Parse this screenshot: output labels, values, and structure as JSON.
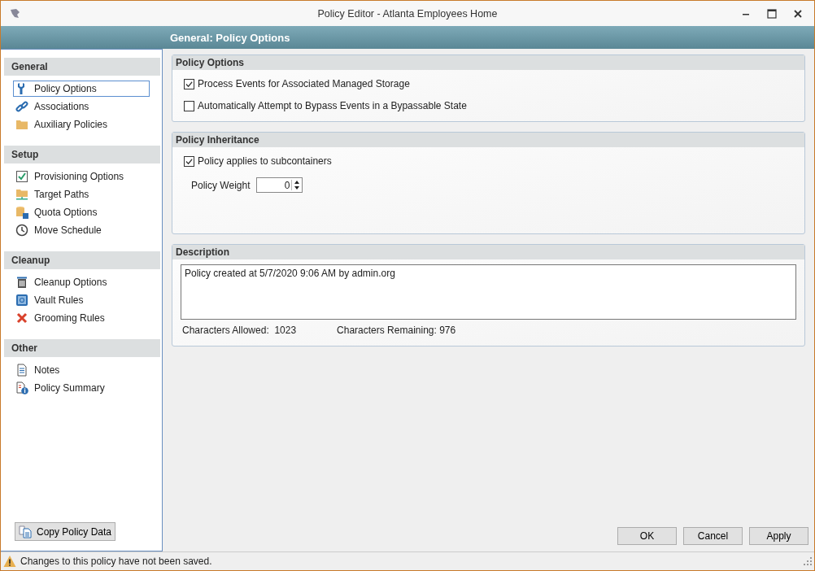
{
  "window": {
    "title": "Policy Editor - Atlanta Employees Home"
  },
  "header": {
    "title": "General: Policy Options"
  },
  "sidebar": {
    "sections": [
      {
        "title": "General",
        "items": [
          {
            "label": "Policy Options",
            "selected": true
          },
          {
            "label": "Associations",
            "selected": false
          },
          {
            "label": "Auxiliary Policies",
            "selected": false
          }
        ]
      },
      {
        "title": "Setup",
        "items": [
          {
            "label": "Provisioning Options",
            "selected": false
          },
          {
            "label": "Target Paths",
            "selected": false
          },
          {
            "label": "Quota Options",
            "selected": false
          },
          {
            "label": "Move Schedule",
            "selected": false
          }
        ]
      },
      {
        "title": "Cleanup",
        "items": [
          {
            "label": "Cleanup Options",
            "selected": false
          },
          {
            "label": "Vault Rules",
            "selected": false
          },
          {
            "label": "Grooming Rules",
            "selected": false
          }
        ]
      },
      {
        "title": "Other",
        "items": [
          {
            "label": "Notes",
            "selected": false
          },
          {
            "label": "Policy Summary",
            "selected": false
          }
        ]
      }
    ],
    "copy_button": "Copy Policy Data"
  },
  "policy_options": {
    "title": "Policy Options",
    "checkboxes": [
      {
        "label": "Process Events for Associated Managed Storage",
        "checked": true
      },
      {
        "label": "Automatically Attempt to Bypass Events in a Bypassable State",
        "checked": false
      }
    ]
  },
  "policy_inheritance": {
    "title": "Policy Inheritance",
    "checkboxes": [
      {
        "label": "Policy applies to subcontainers",
        "checked": true
      }
    ],
    "weight_label": "Policy Weight",
    "weight_value": "0"
  },
  "description": {
    "title": "Description",
    "value": "Policy created at 5/7/2020 9:06 AM by admin.org",
    "allowed_label": "Characters Allowed:",
    "allowed_value": "1023",
    "remaining_label": "Characters Remaining:",
    "remaining_value": "976"
  },
  "buttons": [
    "OK",
    "Cancel",
    "Apply"
  ],
  "status_bar": {
    "message": "Changes to this policy have not been saved."
  }
}
